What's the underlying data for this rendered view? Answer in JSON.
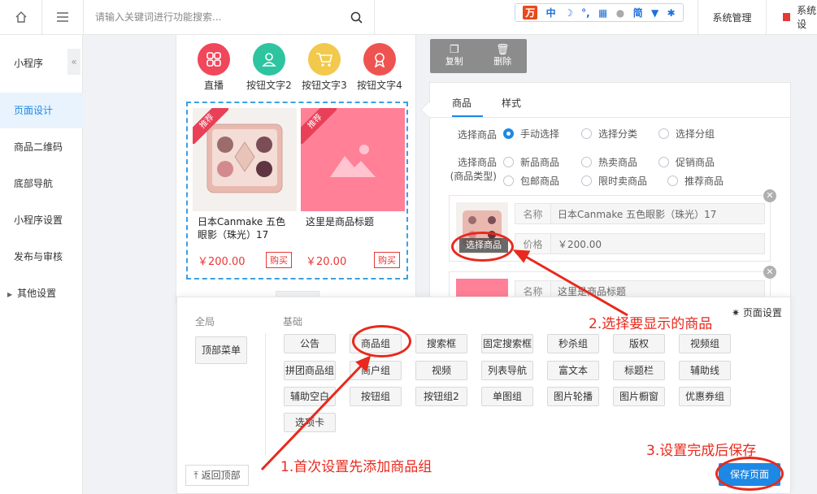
{
  "topbar": {
    "search_placeholder": "请输入关键词进行功能搜索...",
    "toolstrip": [
      "中",
      "简"
    ],
    "sys_mgmt": "系统管理",
    "sys_mgmt2": "系统设"
  },
  "sidebar": {
    "title": "小程序",
    "items": [
      "页面设计",
      "商品二维码",
      "底部导航",
      "小程序设置",
      "发布与审核",
      "其他设置"
    ]
  },
  "phone": {
    "buttons": [
      {
        "label": "直播",
        "color": "#f0475b"
      },
      {
        "label": "按钮文字2",
        "color": "#2ec4a0"
      },
      {
        "label": "按钮文字3",
        "color": "#f2c94c"
      },
      {
        "label": "按钮文字4",
        "color": "#ef5350"
      }
    ],
    "goods": [
      {
        "badge": "推荐",
        "title": "日本Canmake 五色眼影（珠光）17",
        "price": "￥200.00",
        "buy": "购买"
      },
      {
        "badge": "推荐",
        "title": "这里是商品标题",
        "price": "￥20.00",
        "buy": "购买"
      }
    ]
  },
  "toolbar": {
    "copy": "复制",
    "delete": "删除"
  },
  "panel": {
    "tabs": [
      "商品",
      "样式"
    ],
    "select_label": "选择商品",
    "select_options": [
      "手动选择",
      "选择分类",
      "选择分组"
    ],
    "type_label_1": "选择商品",
    "type_label_2": "(商品类型)",
    "type_options": [
      "新品商品",
      "热卖商品",
      "促销商品",
      "包邮商品",
      "限时卖商品",
      "推荐商品"
    ],
    "items": [
      {
        "select_btn": "选择商品",
        "name_label": "名称",
        "name": "日本Canmake 五色眼影（珠光）17",
        "price_label": "价格",
        "price": "￥200.00"
      },
      {
        "name_label": "名称",
        "name": "这里是商品标题"
      }
    ]
  },
  "library": {
    "global_title": "全局",
    "basic_title": "基础",
    "top_menu": "顶部菜单",
    "page_settings": "页面设置",
    "components": [
      "公告",
      "商品组",
      "搜索框",
      "固定搜索框",
      "秒杀组",
      "版权",
      "视频组",
      "拼团商品组",
      "商户组",
      "视频",
      "列表导航",
      "富文本",
      "标题栏",
      "辅助线",
      "辅助空白",
      "按钮组",
      "按钮组2",
      "单图组",
      "图片轮播",
      "图片橱窗",
      "优惠券组",
      "选项卡"
    ],
    "back_top": "返回顶部",
    "save": "保存页面"
  },
  "annotations": {
    "step1": "1.首次设置先添加商品组",
    "step2": "2.选择要显示的商品",
    "step3": "3.设置完成后保存",
    "color": "#e8291d"
  }
}
